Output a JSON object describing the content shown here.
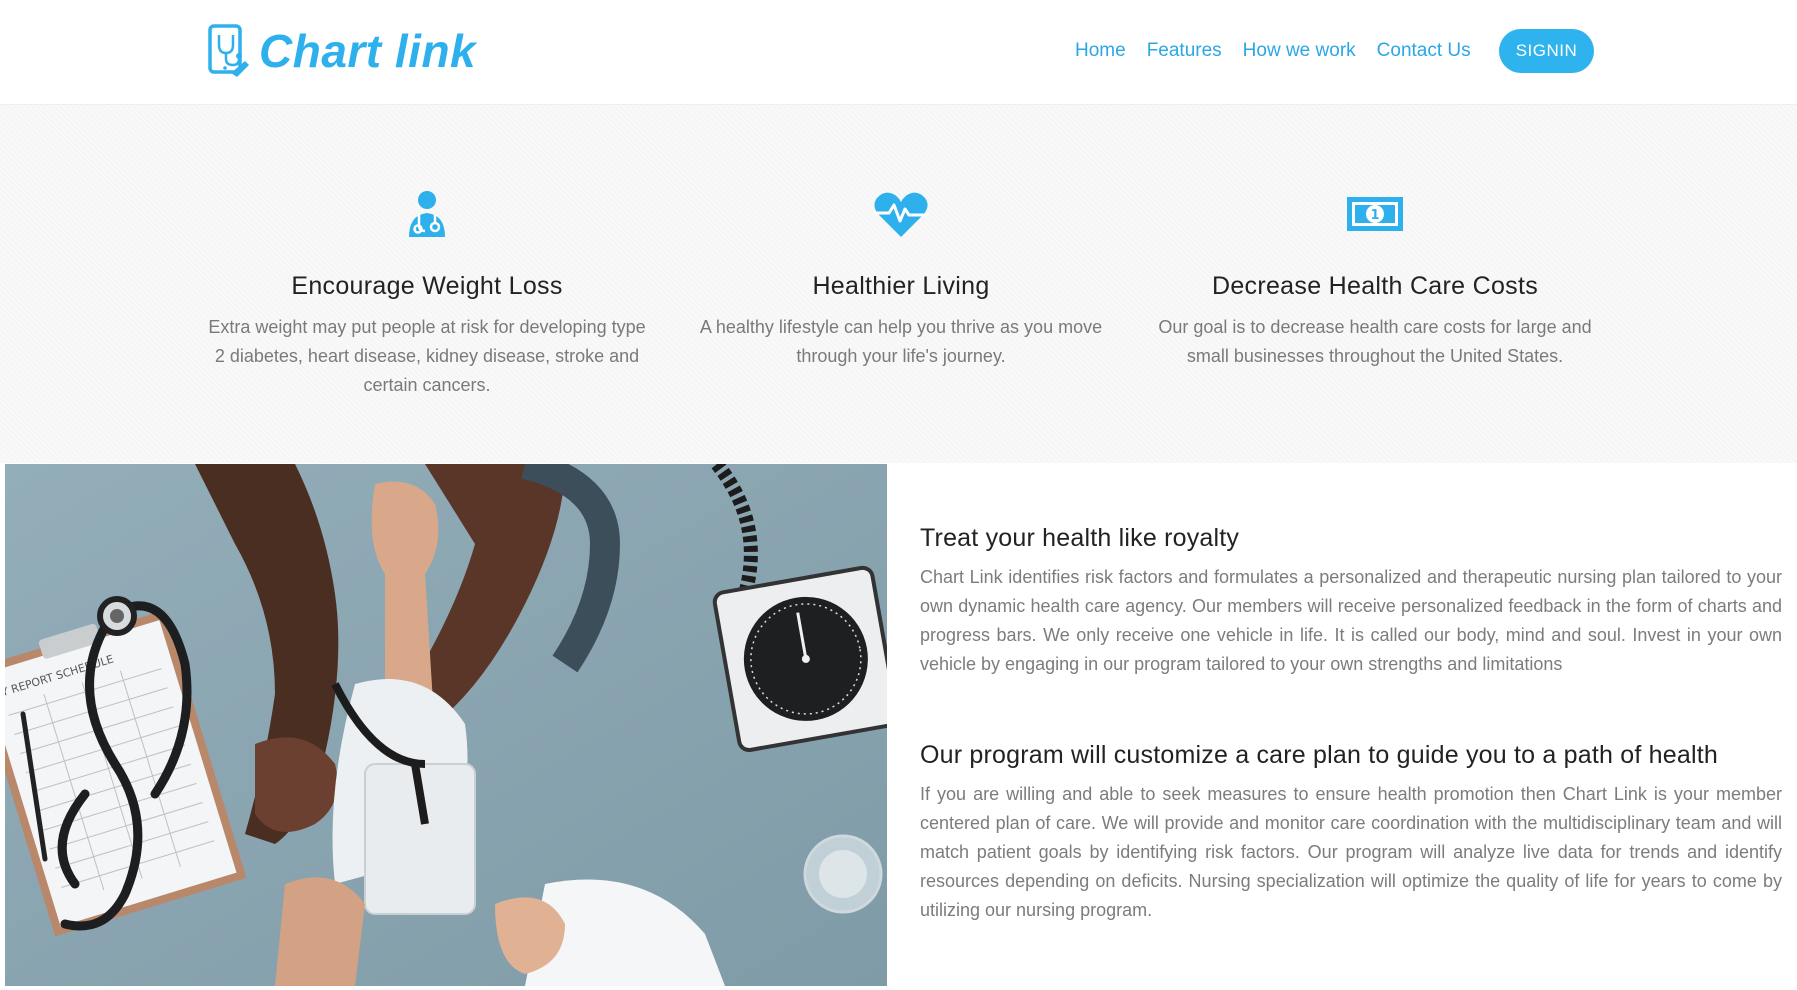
{
  "header": {
    "logo_text": "Chart link",
    "nav": [
      {
        "label": "Home"
      },
      {
        "label": "Features"
      },
      {
        "label": "How we work"
      },
      {
        "label": "Contact Us"
      }
    ],
    "signin_label": "SIGNIN"
  },
  "colors": {
    "brand": "#2eb0ec",
    "nav_link": "#2ba7e6",
    "heading": "#222222",
    "body_text": "#7a7a7a",
    "band_background": "#f6f6f6"
  },
  "features": [
    {
      "icon": "doctor-icon",
      "title": "Encourage Weight Loss",
      "text": "Extra weight may put people at risk for developing type 2 diabetes, heart disease, kidney disease, stroke and certain cancers."
    },
    {
      "icon": "heartbeat-icon",
      "title": "Healthier Living",
      "text": "A healthy lifestyle can help you thrive as you move through your life's journey."
    },
    {
      "icon": "money-bill-icon",
      "title": "Decrease Health Care Costs",
      "text": "Our goal is to decrease health care costs for large and small businesses throughout the United States."
    }
  ],
  "photo": {
    "subject": "blood-pressure-check-photo",
    "report_label": "Y REPORT SCHEDULE"
  },
  "sections": [
    {
      "title": "Treat your health like royalty",
      "text": "Chart Link identifies risk factors and formulates a personalized and therapeutic nursing plan tailored to your own dynamic health care agency. Our members will receive personalized feedback in the form of charts and progress bars. We only receive one vehicle in life. It is called our body, mind and soul. Invest in your own vehicle by engaging in our program tailored to your own strengths and limitations"
    },
    {
      "title": "Our program will customize a care plan to guide you to a path of health",
      "text": "If you are willing and able to seek measures to ensure health promotion then Chart Link is your member centered plan of care. We will provide and monitor care coordination with the multidisciplinary team and will match patient goals by identifying risk factors. Our program will analyze live data for trends and identify resources depending on deficits. Nursing specialization will optimize the quality of life for years to come by utilizing our nursing program."
    }
  ]
}
